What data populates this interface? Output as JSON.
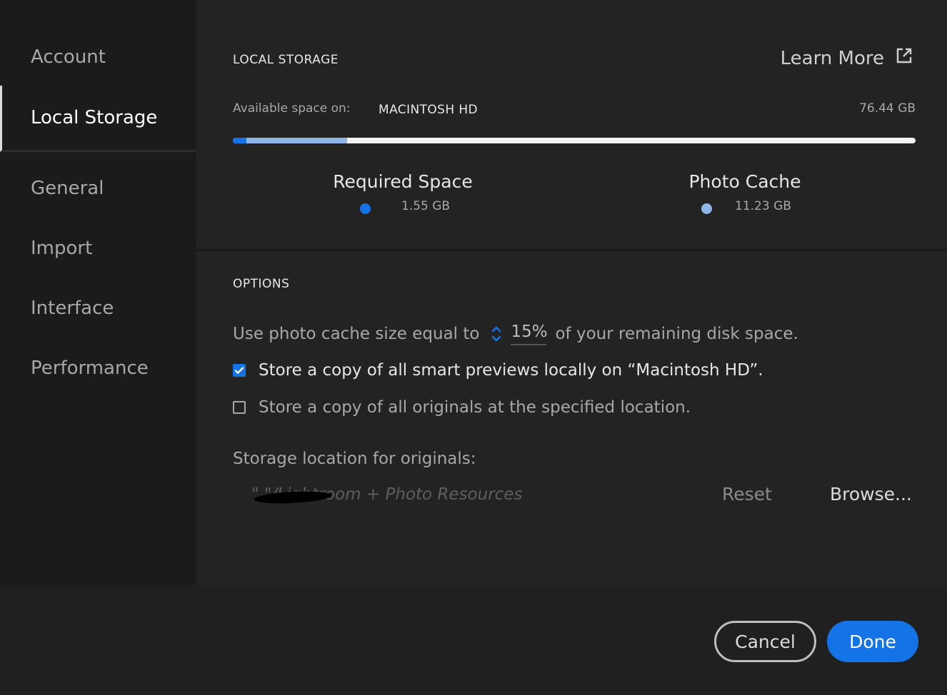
{
  "sidebar": {
    "items": [
      {
        "label": "Account"
      },
      {
        "label": "Local Storage",
        "active": true
      },
      {
        "label": "General"
      },
      {
        "label": "Import"
      },
      {
        "label": "Interface"
      },
      {
        "label": "Performance"
      }
    ]
  },
  "local_storage": {
    "title": "LOCAL STORAGE",
    "learn_more": "Learn More",
    "available_label": "Available space on:",
    "disk_name": "MACINTOSH HD",
    "disk_size": "76.44 GB",
    "usage": {
      "required_fraction": 0.02,
      "cache_fraction": 0.147
    },
    "legend": [
      {
        "title": "Required Space",
        "value": "1.55 GB",
        "color": "#1473e6"
      },
      {
        "title": "Photo Cache",
        "value": "11.23 GB",
        "color": "#8fb6e6"
      }
    ]
  },
  "options": {
    "title": "OPTIONS",
    "cache_prefix": "Use photo cache size equal to",
    "cache_percent": "15%",
    "cache_suffix": "of your remaining disk space.",
    "smart_previews": {
      "label": "Store a copy of all smart previews locally on “Macintosh HD”.",
      "checked": true
    },
    "originals": {
      "label": "Store a copy of all originals at the specified location.",
      "checked": false
    },
    "storage_location_label": "Storage location for originals:",
    "storage_path": "\"           \"/Lightroom + Photo Resources",
    "reset_label": "Reset",
    "browse_label": "Browse..."
  },
  "footer": {
    "cancel_label": "Cancel",
    "done_label": "Done"
  },
  "colors": {
    "accent": "#1473e6",
    "cache": "#8fb6e6"
  }
}
